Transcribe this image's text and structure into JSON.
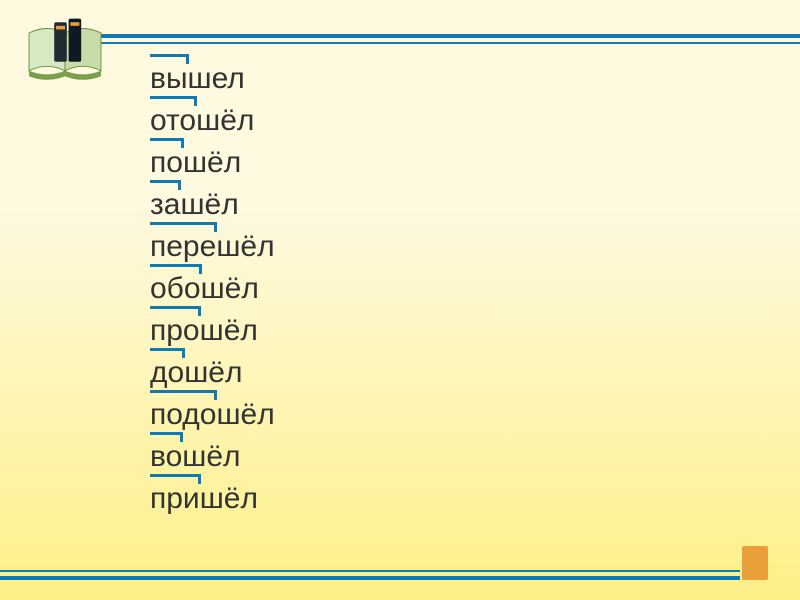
{
  "words": [
    {
      "prefix": "вы",
      "root": "шел"
    },
    {
      "prefix": "ото",
      "root": "шёл"
    },
    {
      "prefix": "по",
      "root": "шёл"
    },
    {
      "prefix": "за",
      "root": "шёл"
    },
    {
      "prefix": "пере",
      "root": "шёл"
    },
    {
      "prefix": "обо",
      "root": "шёл"
    },
    {
      "prefix": "про",
      "root": "шёл"
    },
    {
      "prefix": "до",
      "root": "шёл"
    },
    {
      "prefix": "подо",
      "root": "шёл"
    },
    {
      "prefix": "во",
      "root": "шёл"
    },
    {
      "prefix": "при",
      "root": "шёл"
    }
  ],
  "colors": {
    "rule": "#0e7bb6",
    "accent": "#e9a03a"
  }
}
